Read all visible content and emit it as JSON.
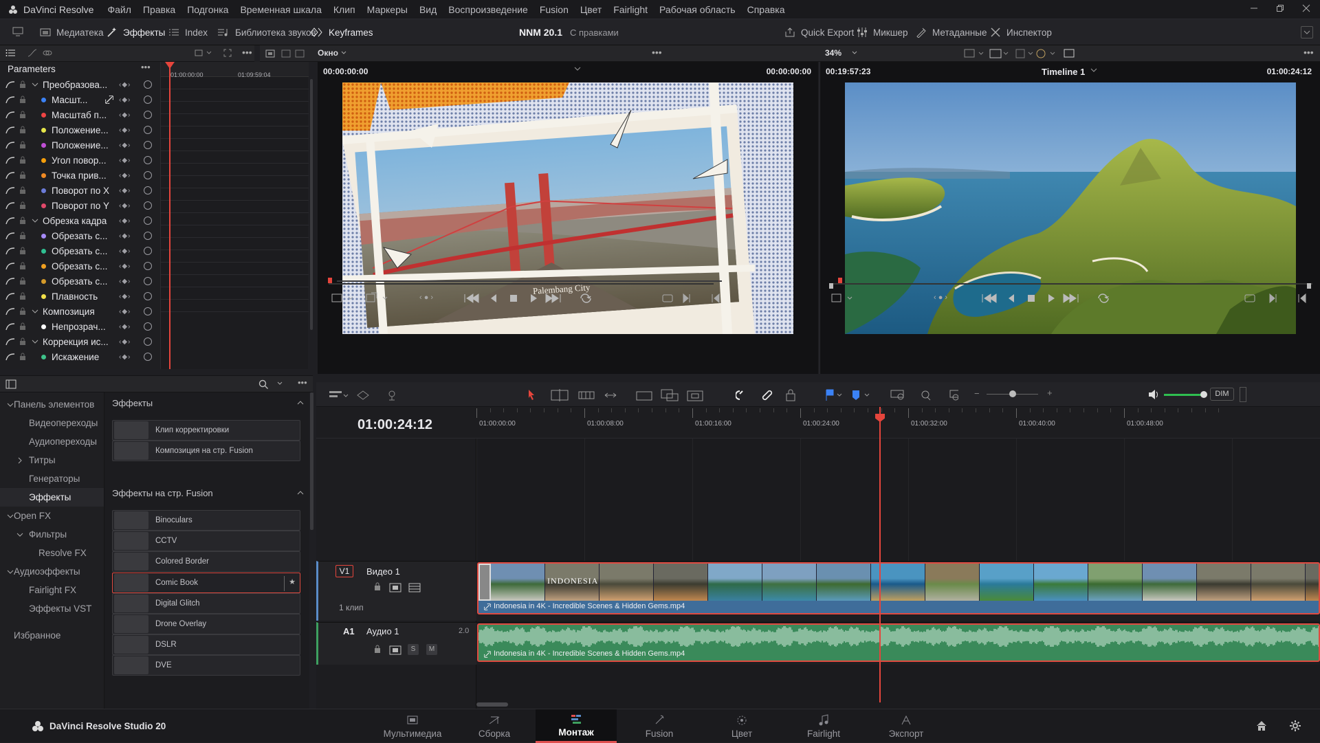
{
  "app": {
    "name": "DaVinci Resolve",
    "menu": [
      "Файл",
      "Правка",
      "Подгонка",
      "Временная шкала",
      "Клип",
      "Маркеры",
      "Вид",
      "Воспроизведение",
      "Fusion",
      "Цвет",
      "Fairlight",
      "Рабочая область",
      "Справка"
    ]
  },
  "toolbar": {
    "left": [
      {
        "label": "Медиатека",
        "icon": "media-pool-icon"
      },
      {
        "label": "Эффекты",
        "icon": "effects-icon"
      },
      {
        "label": "Index",
        "icon": "index-icon"
      },
      {
        "label": "Библиотека звуков",
        "icon": "sound-library-icon"
      },
      {
        "label": "Keyframes",
        "icon": "keyframes-icon"
      }
    ],
    "project": "NNM 20.1",
    "project_status": "С правками",
    "right": [
      {
        "label": "Quick Export",
        "icon": "export-icon"
      },
      {
        "label": "Микшер",
        "icon": "mixer-icon"
      },
      {
        "label": "Метаданные",
        "icon": "metadata-icon"
      },
      {
        "label": "Инспектор",
        "icon": "inspector-icon"
      }
    ]
  },
  "subbar": {
    "window_select": "Окно",
    "zoom": "34%"
  },
  "keyframes": {
    "title": "Parameters",
    "ruler": [
      "01:00:00:00",
      "01:09:59:04"
    ],
    "rows": [
      {
        "label": "Преобразова...",
        "level": 0,
        "expand": true,
        "color": ""
      },
      {
        "label": "Масшт...",
        "level": 1,
        "color": "#3b82f6",
        "link": true
      },
      {
        "label": "Масштаб п...",
        "level": 1,
        "color": "#ef4444"
      },
      {
        "label": "Положение...",
        "level": 1,
        "color": "#e5e54a"
      },
      {
        "label": "Положение...",
        "level": 1,
        "color": "#c04fd6"
      },
      {
        "label": "Угол повор...",
        "level": 1,
        "color": "#f59e0b"
      },
      {
        "label": "Точка прив...",
        "level": 1,
        "color": "#f08a24"
      },
      {
        "label": "Поворот по X",
        "level": 1,
        "color": "#6b7bd8"
      },
      {
        "label": "Поворот по Y",
        "level": 1,
        "color": "#e2486a"
      },
      {
        "label": "Обрезка кадра",
        "level": 0,
        "expand": true,
        "color": ""
      },
      {
        "label": "Обрезать с...",
        "level": 1,
        "color": "#a78bfa"
      },
      {
        "label": "Обрезать с...",
        "level": 1,
        "color": "#2fbf91"
      },
      {
        "label": "Обрезать с...",
        "level": 1,
        "color": "#f0a020"
      },
      {
        "label": "Обрезать с...",
        "level": 1,
        "color": "#d49a2a"
      },
      {
        "label": "Плавность",
        "level": 1,
        "color": "#f2e04a"
      },
      {
        "label": "Композиция",
        "level": 0,
        "expand": true,
        "color": ""
      },
      {
        "label": "Непрозрач...",
        "level": 1,
        "color": "#ffffff"
      },
      {
        "label": "Коррекция ис...",
        "level": 0,
        "expand": true,
        "color": ""
      },
      {
        "label": "Искажение",
        "level": 1,
        "color": "#3ec28a"
      }
    ]
  },
  "source_viewer": {
    "tc_left": "00:00:00:00",
    "tc_right": "00:00:00:00",
    "caption": "Palembang City"
  },
  "timeline_viewer": {
    "tc_left": "00:19:57:23",
    "name": "Timeline 1",
    "tc_right": "01:00:24:12"
  },
  "library": {
    "tree": [
      {
        "label": "Панель элементов",
        "level": 0,
        "arrow": "down"
      },
      {
        "label": "Видеопереходы",
        "level": 1
      },
      {
        "label": "Аудиопереходы",
        "level": 1
      },
      {
        "label": "Титры",
        "level": 1,
        "arrow": "right"
      },
      {
        "label": "Генераторы",
        "level": 1
      },
      {
        "label": "Эффекты",
        "level": 1,
        "active": true
      },
      {
        "label": "Open FX",
        "level": 0,
        "arrow": "down"
      },
      {
        "label": "Фильтры",
        "level": 1,
        "arrow": "down"
      },
      {
        "label": "Resolve FX",
        "level": 2
      },
      {
        "label": "Аудиоэффекты",
        "level": 0,
        "arrow": "down"
      },
      {
        "label": "Fairlight FX",
        "level": 1
      },
      {
        "label": "Эффекты VST",
        "level": 1
      },
      {
        "label": "Избранное",
        "level": 0,
        "gap": true
      }
    ],
    "section1": "Эффекты",
    "section1_items": [
      "Клип корректировки",
      "Композиция на стр. Fusion"
    ],
    "section2": "Эффекты на стр. Fusion",
    "section2_items": [
      "Binoculars",
      "CCTV",
      "Colored Border",
      "Comic Book",
      "Digital Glitch",
      "Drone Overlay",
      "DSLR",
      "DVE"
    ],
    "selected": "Comic Book"
  },
  "timeline": {
    "timecode": "01:00:24:12",
    "ruler": [
      "01:00:00:00",
      "01:00:08:00",
      "01:00:16:00",
      "01:00:24:00",
      "01:00:32:00",
      "01:00:40:00",
      "01:00:48:00"
    ],
    "dim_label": "DIM",
    "video_track": {
      "id": "V1",
      "name": "Видео 1",
      "clips": "1 клип"
    },
    "audio_track": {
      "id": "A1",
      "name": "Аудио 1",
      "channels": "2.0",
      "solo": "S",
      "mute": "M"
    },
    "clip_name": "Indonesia in 4K - Incredible Scenes & Hidden Gems.mp4",
    "thumb_title": "Indonesia"
  },
  "bottom": {
    "brand": "DaVinci Resolve Studio 20",
    "pages": [
      {
        "label": "Мультимедиа",
        "icon": "media-page-icon"
      },
      {
        "label": "Сборка",
        "icon": "cut-page-icon"
      },
      {
        "label": "Монтаж",
        "icon": "edit-page-icon",
        "active": true
      },
      {
        "label": "Fusion",
        "icon": "fusion-page-icon"
      },
      {
        "label": "Цвет",
        "icon": "color-page-icon"
      },
      {
        "label": "Fairlight",
        "icon": "fairlight-page-icon"
      },
      {
        "label": "Экспорт",
        "icon": "deliver-page-icon"
      }
    ]
  },
  "colors": {
    "accent": "#e64a4a",
    "video_clip": "#3f6d9a",
    "audio_clip": "#3a8a5a",
    "playhead": "#e5453c"
  }
}
